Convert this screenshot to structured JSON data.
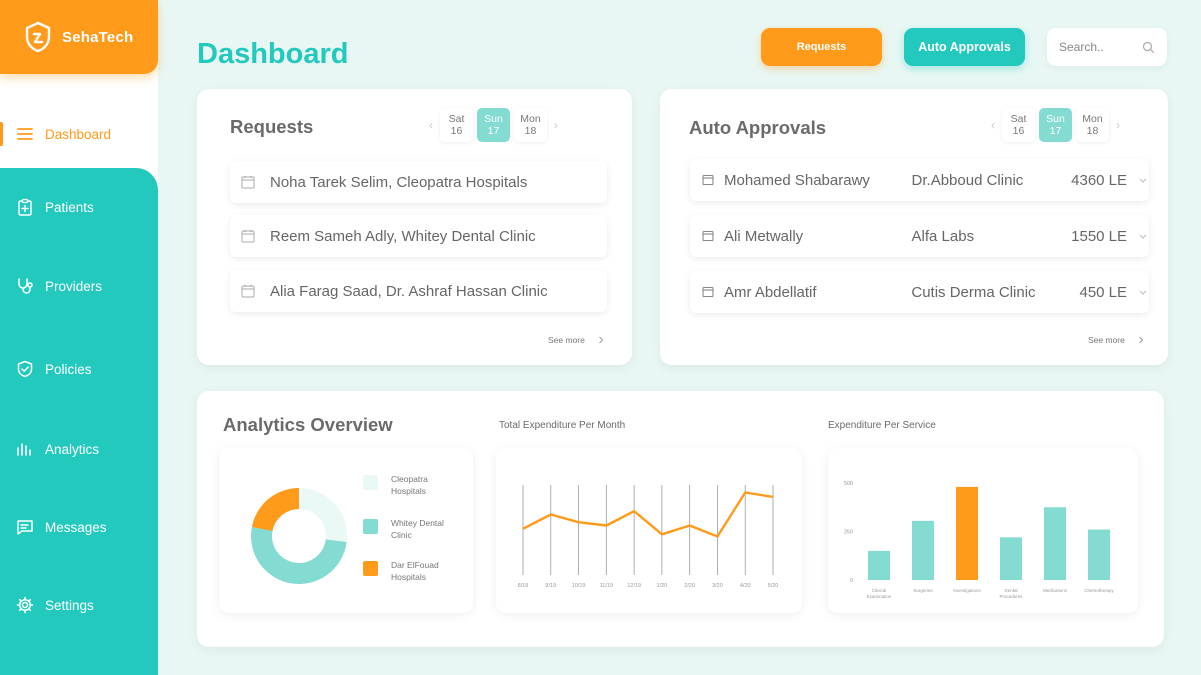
{
  "app": {
    "name": "SehaTech"
  },
  "colors": {
    "teal": "#23c9bd",
    "orange": "#ff9a1a",
    "light_teal": "#84dbd1",
    "pale_teal": "#eaf8f6"
  },
  "sidebar": {
    "items": [
      {
        "label": "Dashboard",
        "icon": "menu-icon"
      },
      {
        "label": "Patients",
        "icon": "clipboard-plus-icon"
      },
      {
        "label": "Providers",
        "icon": "stethoscope-icon"
      },
      {
        "label": "Policies",
        "icon": "shield-check-icon"
      },
      {
        "label": "Analytics",
        "icon": "bar-chart-icon"
      },
      {
        "label": "Messages",
        "icon": "message-icon"
      },
      {
        "label": "Settings",
        "icon": "gear-icon"
      }
    ]
  },
  "header": {
    "title": "Dashboard",
    "requests_label": "Requests",
    "auto_label": "Auto Approvals",
    "search_placeholder": "Search.."
  },
  "requests": {
    "title": "Requests",
    "dates": [
      {
        "day": "Sat",
        "num": "16"
      },
      {
        "day": "Sun",
        "num": "17"
      },
      {
        "day": "Mon",
        "num": "18"
      }
    ],
    "selected_date": "Sun 17",
    "items": [
      "Noha Tarek Selim, Cleopatra Hospitals",
      "Reem Sameh Adly, Whitey Dental Clinic",
      "Alia Farag Saad, Dr. Ashraf Hassan Clinic"
    ],
    "see_more": "See more"
  },
  "auto_approvals": {
    "title": "Auto Approvals",
    "dates": [
      {
        "day": "Sat",
        "num": "16"
      },
      {
        "day": "Sun",
        "num": "17"
      },
      {
        "day": "Mon",
        "num": "18"
      }
    ],
    "selected_date": "Sun 17",
    "items": [
      {
        "name": "Mohamed Shabarawy",
        "clinic": "Dr.Abboud Clinic",
        "amount": "4360 LE"
      },
      {
        "name": "Ali Metwally",
        "clinic": "Alfa Labs",
        "amount": "1550 LE"
      },
      {
        "name": "Amr Abdellatif",
        "clinic": "Cutis Derma Clinic",
        "amount": "450 LE"
      }
    ],
    "see_more": "See more"
  },
  "analytics": {
    "title": "Analytics Overview",
    "monthly_title": "Total Expenditure Per Month",
    "service_title": "Expenditure Per Service"
  },
  "chart_data": [
    {
      "type": "pie",
      "title": "",
      "labels": [
        "Cleopatra Hospitals",
        "Whitey Dental Clinic",
        "Dar ElFouad Hospitals"
      ],
      "values": [
        27,
        51,
        22
      ],
      "colors": [
        "#eaf8f6",
        "#84dbd1",
        "#ff9a1a"
      ],
      "donut": true
    },
    {
      "type": "line",
      "title": "Total Expenditure Per Month",
      "categories": [
        "8/19",
        "9/19",
        "10/19",
        "11/19",
        "12/19",
        "1/20",
        "2/20",
        "3/20",
        "4/20",
        "5/20"
      ],
      "values": [
        42,
        55,
        48,
        45,
        58,
        37,
        45,
        35,
        75,
        71
      ],
      "ylim": [
        0,
        100
      ],
      "color": "#ff9a1a",
      "grid": "vertical"
    },
    {
      "type": "bar",
      "title": "Expenditure Per Service",
      "categories": [
        "Clinical Examination",
        "Surgeries",
        "Investigations",
        "Dental Procedures",
        "Medications",
        "Chemotherapy"
      ],
      "values": [
        150,
        305,
        480,
        220,
        375,
        260
      ],
      "highlight_index": 2,
      "ylim": [
        0,
        500
      ],
      "yticks": [
        "0",
        "250",
        "500"
      ],
      "colors": {
        "default": "#84dbd1",
        "highlight": "#ff9a1a"
      }
    }
  ]
}
